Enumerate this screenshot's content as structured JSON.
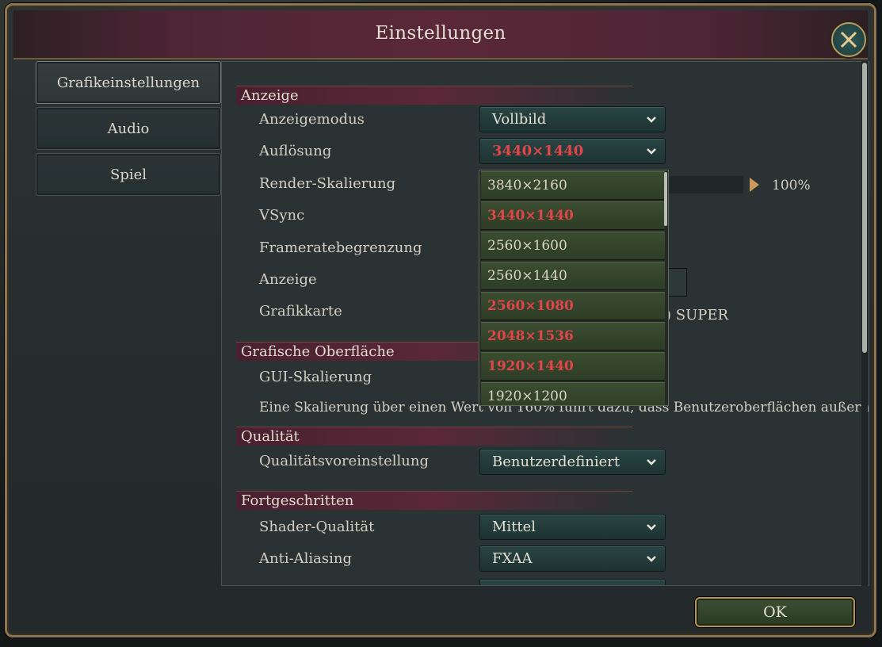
{
  "dialog": {
    "title": "Einstellungen",
    "ok_label": "OK"
  },
  "tabs": [
    {
      "label": "Grafikeinstellungen",
      "active": true
    },
    {
      "label": "Audio",
      "active": false
    },
    {
      "label": "Spiel",
      "active": false
    }
  ],
  "sections": {
    "anzeige": "Anzeige",
    "oberflaeche": "Grafische Oberfläche",
    "qualitaet": "Qualität",
    "fortgeschritten": "Fortgeschritten"
  },
  "settings": {
    "anzeigemodus": {
      "label": "Anzeigemodus",
      "value": "Vollbild"
    },
    "aufloesung": {
      "label": "Auflösung",
      "value": "3440×1440"
    },
    "render_skalierung": {
      "label": "Render-Skalierung",
      "value": "100%"
    },
    "vsync": {
      "label": "VSync"
    },
    "framerate": {
      "label": "Frameratebegrenzung"
    },
    "anzeige": {
      "label": "Anzeige"
    },
    "grafikkarte": {
      "label": "Grafikkarte",
      "value_partial": ") SUPER"
    },
    "gui_skalierung": {
      "label": "GUI-Skalierung"
    },
    "gui_hint": "Eine Skalierung über einen Wert von 160% führt dazu, dass Benutzeroberflächen außerhalb des Bi",
    "qualitaetsvoreinstellung": {
      "label": "Qualitätsvoreinstellung",
      "value": "Benutzerdefiniert"
    },
    "shader_qualitaet": {
      "label": "Shader-Qualität",
      "value": "Mittel"
    },
    "anti_aliasing": {
      "label": "Anti-Aliasing",
      "value": "FXAA"
    }
  },
  "resolution_options": [
    {
      "label": "3840×2160",
      "highlight": false
    },
    {
      "label": "3440×1440",
      "highlight": true
    },
    {
      "label": "2560×1600",
      "highlight": false
    },
    {
      "label": "2560×1440",
      "highlight": false
    },
    {
      "label": "2560×1080",
      "highlight": true
    },
    {
      "label": "2048×1536",
      "highlight": true
    },
    {
      "label": "1920×1440",
      "highlight": true
    },
    {
      "label": "1920×1200",
      "highlight": false
    }
  ],
  "colors": {
    "accent_red": "#e0454a",
    "gold_border": "#b89456",
    "title_bar": "#5a2838"
  }
}
